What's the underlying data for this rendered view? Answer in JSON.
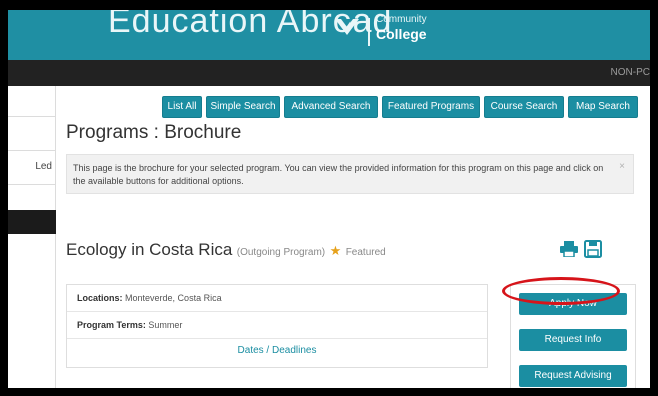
{
  "header": {
    "title": "Education Abroad",
    "subtitle_top": "Community",
    "subtitle_bottom": "College"
  },
  "navbar": {
    "right_text": "NON-PC"
  },
  "sidebar": {
    "items": [
      {
        "label": ""
      },
      {
        "label": "Led"
      },
      {
        "label": ""
      }
    ]
  },
  "toolbar": {
    "buttons": [
      {
        "label": "List All"
      },
      {
        "label": "Simple Search"
      },
      {
        "label": "Advanced Search"
      },
      {
        "label": "Featured Programs"
      },
      {
        "label": "Course Search"
      },
      {
        "label": "Map Search"
      }
    ]
  },
  "page": {
    "title": "Programs : Brochure",
    "info_text": "This page is the brochure for your selected program. You can view the provided information for this program on this page and click on the available buttons for additional options.",
    "info_close": "×"
  },
  "program": {
    "name": "Ecology in Costa Rica",
    "type": "(Outgoing Program)",
    "featured": "Featured",
    "star": "★",
    "details": {
      "locations_label": "Locations:",
      "locations_value": "Monteverde, Costa Rica",
      "terms_label": "Program Terms:",
      "terms_value": "Summer",
      "dates_link": "Dates / Deadlines"
    }
  },
  "actions": {
    "apply": "Apply Now",
    "request_info": "Request Info",
    "request_advising": "Request Advising"
  },
  "colors": {
    "brand_teal": "#1f8fa3",
    "button_teal": "#1b8ea2",
    "highlight_red": "#d6141a",
    "star_gold": "#e6a11b"
  },
  "icons": [
    "shield-logo-icon",
    "print-icon",
    "save-icon",
    "star-icon",
    "close-icon"
  ]
}
